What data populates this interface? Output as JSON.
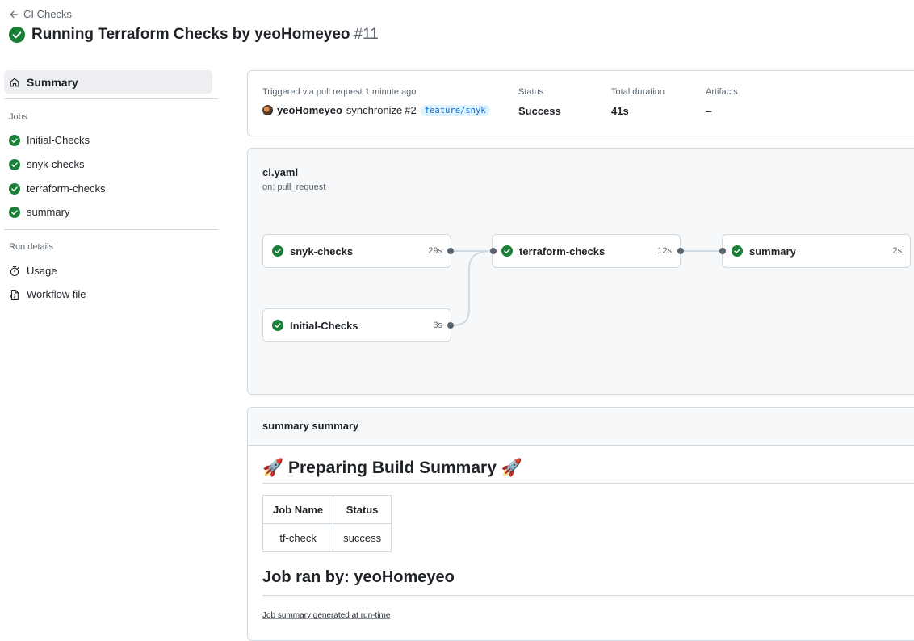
{
  "header": {
    "back_label": "CI Checks",
    "title": "Running Terraform Checks by yeoHomeyeo",
    "run_number": "#11"
  },
  "sidebar": {
    "summary_label": "Summary",
    "jobs_heading": "Jobs",
    "jobs": [
      {
        "label": "Initial-Checks"
      },
      {
        "label": "snyk-checks"
      },
      {
        "label": "terraform-checks"
      },
      {
        "label": "summary"
      }
    ],
    "run_details_heading": "Run details",
    "usage_label": "Usage",
    "workflow_file_label": "Workflow file"
  },
  "run_summary": {
    "trigger_label": "Triggered via pull request 1 minute ago",
    "actor": "yeoHomeyeo",
    "action": "synchronize",
    "pr": "#2",
    "branch": "feature/snyk",
    "status_label": "Status",
    "status_value": "Success",
    "duration_label": "Total duration",
    "duration_value": "41s",
    "artifacts_label": "Artifacts",
    "artifacts_value": "–"
  },
  "workflow": {
    "file": "ci.yaml",
    "trigger": "on: pull_request",
    "jobs": [
      {
        "name": "snyk-checks",
        "duration": "29s"
      },
      {
        "name": "Initial-Checks",
        "duration": "3s"
      },
      {
        "name": "terraform-checks",
        "duration": "12s"
      },
      {
        "name": "summary",
        "duration": "2s"
      }
    ]
  },
  "job_summary": {
    "header": "summary summary",
    "heading": "🚀 Preparing Build Summary 🚀",
    "table": {
      "headers": [
        "Job Name",
        "Status"
      ],
      "rows": [
        [
          "tf-check",
          "success"
        ]
      ]
    },
    "subheading": "Job ran by: yeoHomeyeo",
    "footer_link": "Job summary generated at run-time"
  },
  "colors": {
    "success": "#1a7f37",
    "accent": "#0969da",
    "border": "#d1d9e0"
  }
}
